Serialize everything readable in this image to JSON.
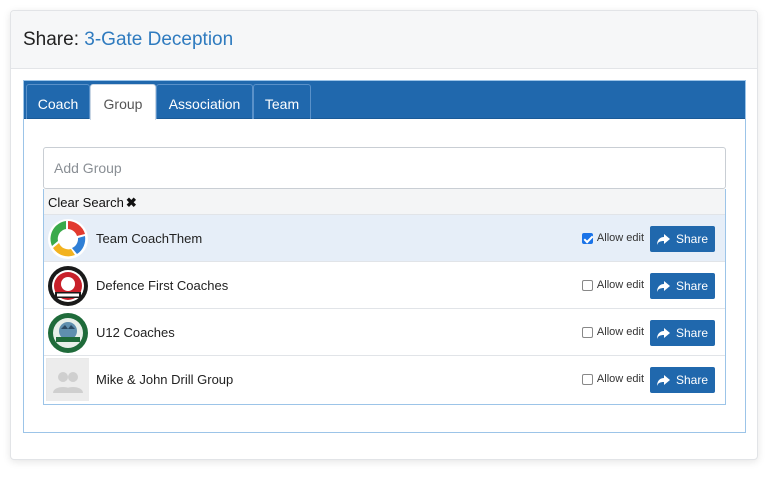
{
  "header": {
    "prefix": "Share:",
    "doc_name": "3-Gate Deception"
  },
  "tabs": [
    {
      "label": "Coach",
      "active": false
    },
    {
      "label": "Group",
      "active": true
    },
    {
      "label": "Association",
      "active": false
    },
    {
      "label": "Team",
      "active": false
    }
  ],
  "search": {
    "placeholder": "Add Group",
    "value": ""
  },
  "clear_search": {
    "label": "Clear Search",
    "icon": "close-icon"
  },
  "groups": [
    {
      "name": "Team CoachThem",
      "allow_edit_label": "Allow edit",
      "allow_edit": true,
      "share_label": "Share",
      "logo": "coachthem-logo",
      "selected": true
    },
    {
      "name": "Defence First Coaches",
      "allow_edit_label": "Allow edit",
      "allow_edit": false,
      "share_label": "Share",
      "logo": "defence-first-logo",
      "selected": false
    },
    {
      "name": "U12 Coaches",
      "allow_edit_label": "Allow edit",
      "allow_edit": false,
      "share_label": "Share",
      "logo": "wildcats-logo",
      "selected": false
    },
    {
      "name": "Mike & John Drill Group",
      "allow_edit_label": "Allow edit",
      "allow_edit": false,
      "share_label": "Share",
      "logo": "placeholder-avatar",
      "selected": false
    }
  ],
  "colors": {
    "primary": "#2068ad",
    "link": "#2f7bbf",
    "selected_row": "#e6eef8"
  }
}
